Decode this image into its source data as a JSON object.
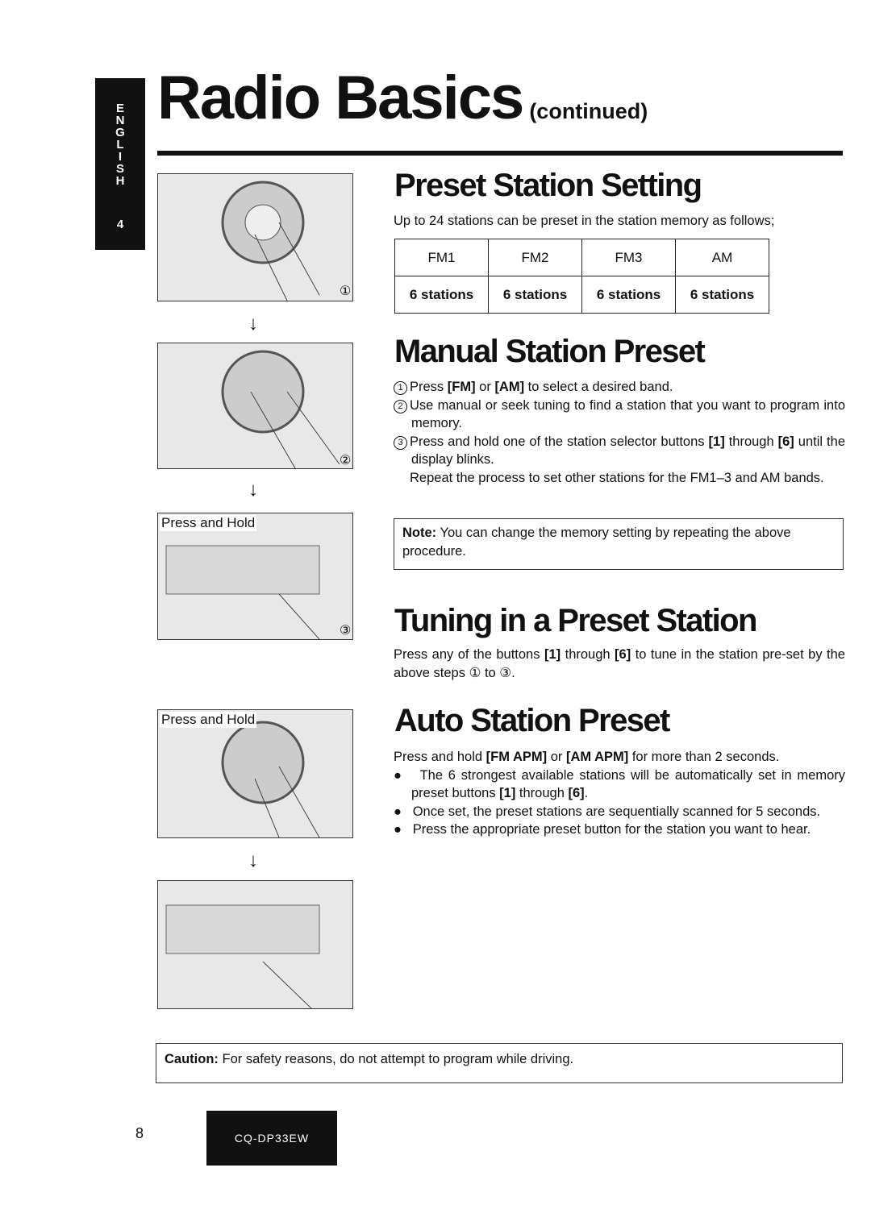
{
  "side_tab": {
    "letters": [
      "E",
      "N",
      "G",
      "L",
      "I",
      "S",
      "H"
    ],
    "number": "4"
  },
  "header": {
    "title": "Radio Basics",
    "suffix": "(continued)"
  },
  "illustrations": {
    "label_press_hold": "Press and Hold",
    "step_1": "①",
    "step_2": "②",
    "step_3": "③",
    "arrow": "↓"
  },
  "preset": {
    "heading": "Preset Station Setting",
    "intro": "Up to 24 stations can be preset in the station memory as follows;",
    "table": {
      "headers": [
        "FM1",
        "FM2",
        "FM3",
        "AM"
      ],
      "values": [
        "6 stations",
        "6 stations",
        "6 stations",
        "6 stations"
      ]
    }
  },
  "manual": {
    "heading": "Manual Station Preset",
    "step1_pre": "Press ",
    "step1_k1": "[FM]",
    "step1_mid": " or ",
    "step1_k2": "[AM]",
    "step1_post": " to select a desired band.",
    "step2": "Use manual or seek tuning to find a station that you want to program into memory.",
    "step3_pre": "Press and hold one of the station selector buttons ",
    "step3_k1": "[1]",
    "step3_mid": " through ",
    "step3_k2": "[6]",
    "step3_post": " until the display blinks.",
    "repeat": "Repeat the process to set other stations for the FM1–3 and AM bands.",
    "note_label": "Note:",
    "note_text": " You can change the memory setting by repeating the above procedure."
  },
  "tuning": {
    "heading": "Tuning in a Preset Station",
    "t1": "Press any of the buttons ",
    "k1": "[1]",
    "t2": " through ",
    "k2": "[6]",
    "t3": " to tune in the station pre-set by the above steps ",
    "s1": "①",
    "t4": " to ",
    "s3": "③",
    "t5": "."
  },
  "auto": {
    "heading": "Auto Station Preset",
    "t1": "Press and hold ",
    "k1": "[FM APM]",
    "t2": " or ",
    "k2": "[AM APM]",
    "t3": " for more than 2 seconds.",
    "b1_pre": "The 6 strongest available stations will be automatically set in memory preset buttons ",
    "b1_k1": "[1]",
    "b1_mid": " through ",
    "b1_k2": "[6]",
    "b1_post": ".",
    "b2": "Once set, the preset stations are sequentially scanned for 5 seconds.",
    "b3": "Press the appropriate preset button for the station you want to hear."
  },
  "caution": {
    "label": "Caution:",
    "text": " For safety reasons, do not attempt to program while driving."
  },
  "footer": {
    "page_number": "8",
    "model": "CQ-DP33EW"
  }
}
